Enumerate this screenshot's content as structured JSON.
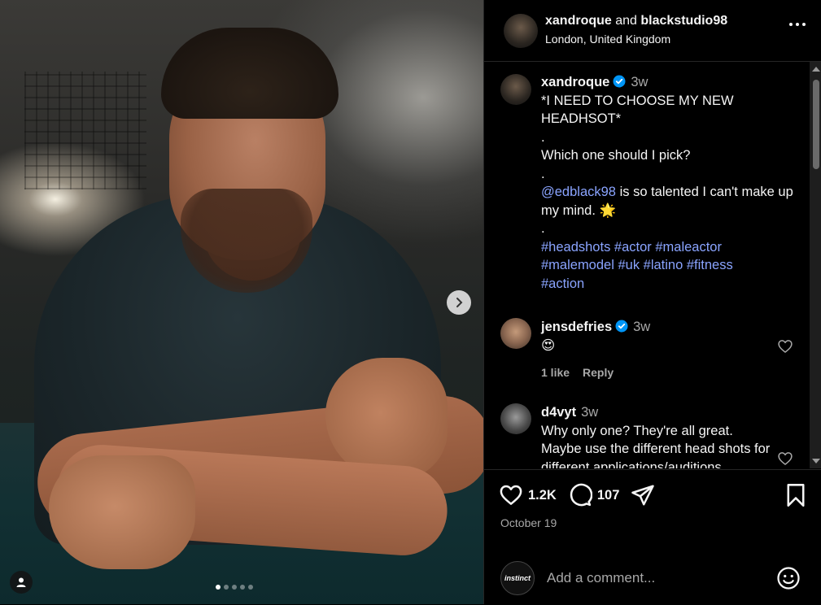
{
  "header": {
    "user1": "xandroque",
    "and_text": "and",
    "user2": "blackstudio98",
    "location": "London, United Kingdom"
  },
  "caption": {
    "username": "xandroque",
    "time": "3w",
    "lines": [
      "*I NEED TO CHOOSE MY NEW",
      "HEADHSOT*",
      ".",
      "Which one should I pick?",
      "."
    ],
    "mention": "@edblack98",
    "mention_rest": " is so talented I can't make up my mind. 🌟",
    "dot_after": ".",
    "hashtags_line1": "#headshots #actor #maleactor",
    "hashtags_line2": "#malemodel #uk #latino #fitness",
    "hashtags_line3": "#action"
  },
  "comments": [
    {
      "username": "jensdefries",
      "time": "3w",
      "text": "😍",
      "likes": "1 like",
      "reply": "Reply"
    },
    {
      "username": "d4vyt",
      "time": "3w",
      "text": "Why only one? They're all great. Maybe use the different head shots for different applications/auditions."
    }
  ],
  "footer": {
    "likes": "1.2K",
    "comments": "107",
    "date": "October 19",
    "comment_placeholder": "Add a comment...",
    "commenter_avatar_text": "instinct"
  },
  "carousel": {
    "total_dots": 5,
    "active_dot": 1
  },
  "colors": {
    "link": "#8aa4ff",
    "verified": "#0095f6",
    "muted": "#a8a8a8"
  }
}
